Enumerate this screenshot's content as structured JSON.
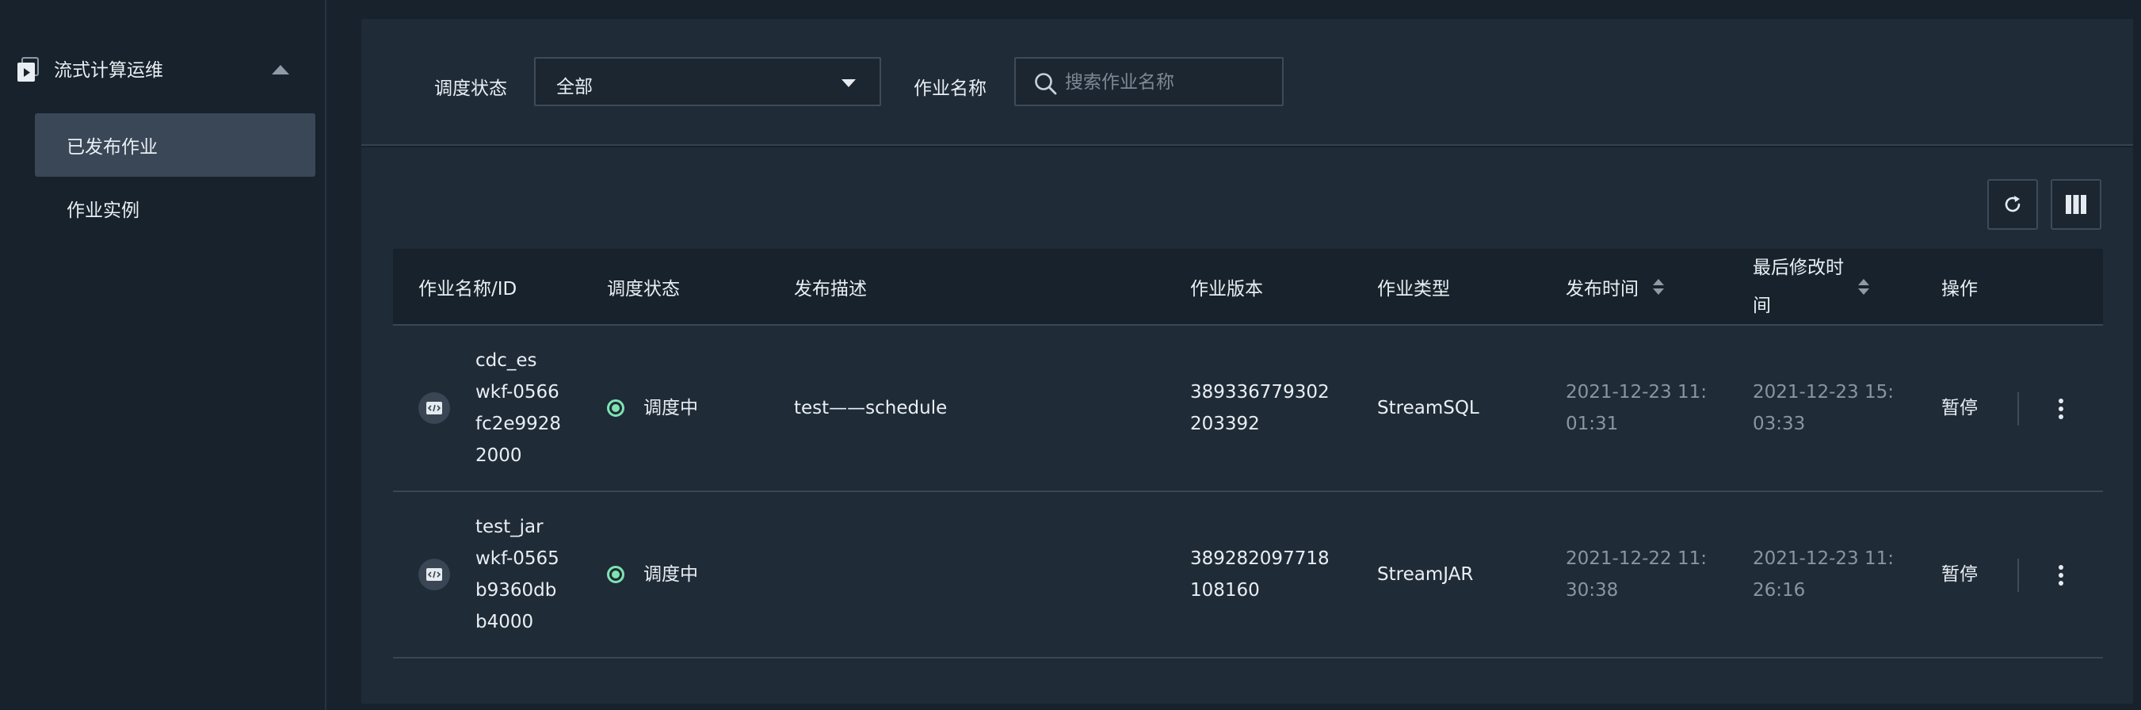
{
  "sidebar": {
    "group_label": "流式计算运维",
    "items": [
      {
        "label": "已发布作业",
        "active": true
      },
      {
        "label": "作业实例",
        "active": false
      }
    ]
  },
  "filters": {
    "status_label": "调度状态",
    "status_value": "全部",
    "name_label": "作业名称",
    "name_placeholder": "搜索作业名称",
    "name_value": ""
  },
  "toolbar": {
    "refresh_icon": "refresh-icon",
    "columns_icon": "columns-icon"
  },
  "table": {
    "columns": [
      "作业名称/ID",
      "调度状态",
      "发布描述",
      "作业版本",
      "作业类型",
      "发布时间",
      "最后修改时",
      "间",
      "操作"
    ],
    "rows": [
      {
        "name_lines": [
          "cdc_es",
          "wkf-0566",
          "fc2e9928",
          "2000"
        ],
        "status": "调度中",
        "description": "test——schedule",
        "version_lines": [
          "389336779302",
          "203392"
        ],
        "type": "StreamSQL",
        "published_lines": [
          "2021-12-23 11:",
          "01:31"
        ],
        "modified_lines": [
          "2021-12-23 15:",
          "03:33"
        ],
        "action": "暂停"
      },
      {
        "name_lines": [
          "test_jar",
          "wkf-0565",
          "b9360db",
          "b4000"
        ],
        "status": "调度中",
        "description": "",
        "version_lines": [
          "389282097718",
          "108160"
        ],
        "type": "StreamJAR",
        "published_lines": [
          "2021-12-22 11:",
          "30:38"
        ],
        "modified_lines": [
          "2021-12-23 11:",
          "26:16"
        ],
        "action": "暂停"
      }
    ]
  },
  "colors": {
    "background": "#18222c",
    "panel": "#1f2b37",
    "status_running": "#7fe3b0"
  }
}
